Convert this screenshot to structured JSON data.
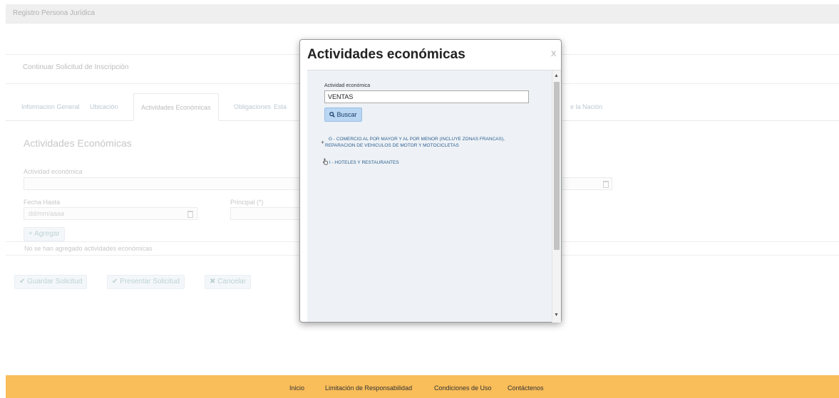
{
  "app": {
    "title": "Registro Persona Jurídica"
  },
  "section": {
    "title": "Continuar Solicitud de Inscripción"
  },
  "tabs": [
    {
      "label": "Informacion General"
    },
    {
      "label": "Ubicación"
    },
    {
      "label": "Actividades Económicas"
    },
    {
      "label": "Obligaciones"
    },
    {
      "label": "Esta"
    },
    {
      "label": "e la Nación"
    }
  ],
  "form": {
    "heading": "Actividades Económicas",
    "activity_label": "Actividad económica",
    "fecha_hasta_label": "Fecha Hasta",
    "fecha_hasta_placeholder": "dd/mm/aaaa",
    "principal_label": "Principal (*)",
    "add_button": "+ Agregar",
    "empty_message": "No se han agregado actividades económicas"
  },
  "actions": {
    "save": "✔ Guardar Solicitud",
    "submit": "✔ Presentar Solicitud",
    "cancel": "✖ Cancelar"
  },
  "modal": {
    "title": "Actividades económicas",
    "close": "X",
    "field_label": "Actividad económica",
    "field_value": "VENTAS",
    "search_button": "Buscar",
    "results": [
      {
        "line1": "G - COMERCIO AL POR MAYOR Y AL POR MENOR (INCLUYE ZONAS FRANCAS),",
        "line2": "REPARACION DE VEHICULOS DE MOTOR Y MOTOCICLETAS"
      },
      {
        "line1": "I - HOTELES Y RESTAURANTES"
      }
    ]
  },
  "footer": {
    "links": [
      "Inicio",
      "Limitación de Responsabilidad",
      "Condiciones de Uso",
      "Contáctenos"
    ],
    "color": "#f9bd5a"
  },
  "colors": {
    "search_button_bg": "#b9d6f3",
    "link": "#2f5f8f"
  }
}
